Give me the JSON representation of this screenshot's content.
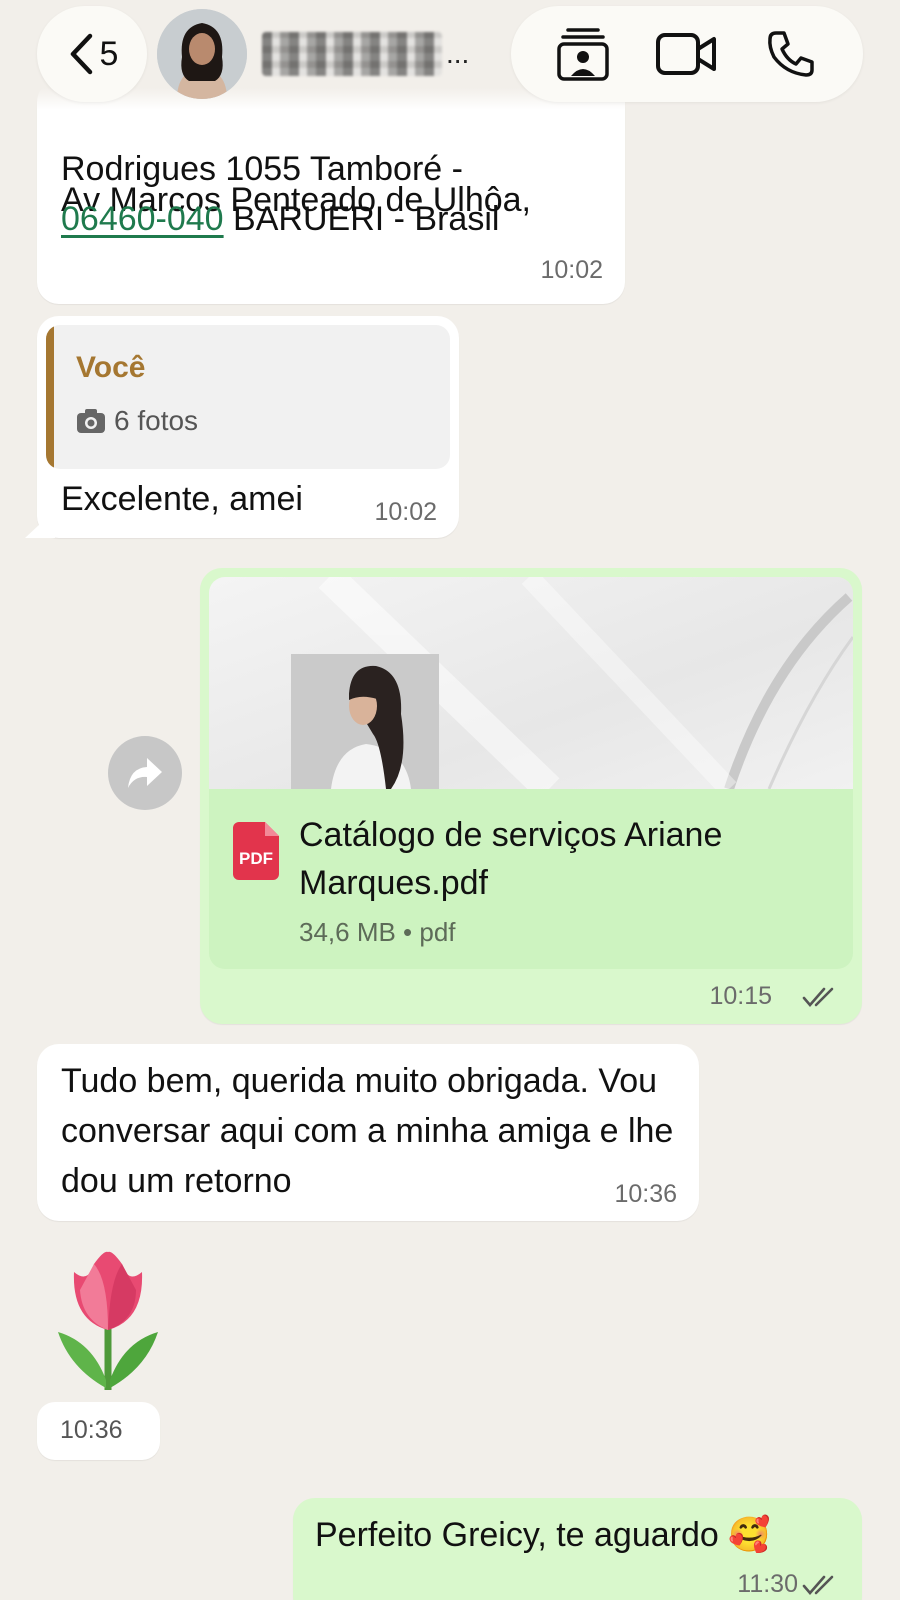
{
  "header": {
    "back_count": "5",
    "contact_name_suffix": "...",
    "icons": [
      "chevron-left-icon",
      "contact-card-icon",
      "video-camera-icon",
      "phone-icon"
    ]
  },
  "messages": {
    "m1": {
      "cut_text": "Av Marcos Penteado de Ulhôa,",
      "line1": "Rodrigues 1055 Tamboré -",
      "zip": "06460-040",
      "line2_rest": " BARUERI - Brasil",
      "time": "10:02"
    },
    "m2": {
      "quote_author": "Você",
      "quote_meta": "6 fotos",
      "text": "Excelente, amei",
      "time": "10:02"
    },
    "m3": {
      "file_name": "Catálogo de serviços Ariane Marques.pdf",
      "file_meta": "34,6 MB • pdf",
      "pdf_label": "PDF",
      "time": "10:15"
    },
    "m4": {
      "text": "Tudo bem, querida muito obrigada. Vou conversar aqui com a minha amiga e lhe dou um retorno",
      "time": "10:36"
    },
    "m5": {
      "emoji": "tulip",
      "time": "10:36"
    },
    "m6": {
      "text": "Perfeito Greicy, te aguardo 🥰",
      "time": "11:30"
    }
  },
  "colors": {
    "background": "#f2efea",
    "incoming_bubble": "#ffffff",
    "outgoing_bubble": "#d9f8cc",
    "quote_accent": "#a57731",
    "link": "#1f7a4d",
    "pdf_red": "#e2344c"
  }
}
